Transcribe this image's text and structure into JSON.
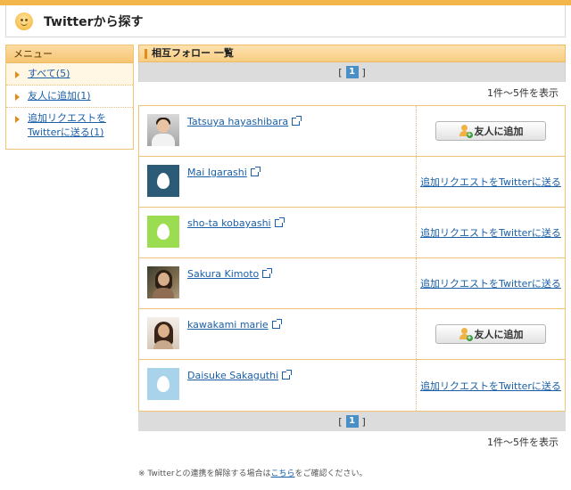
{
  "header": {
    "title": "Twitterから探す"
  },
  "sidebar": {
    "heading": "メニュー",
    "items": [
      {
        "label": "すべて(5)"
      },
      {
        "label": "友人に追加(1)"
      },
      {
        "label_line1": "追加リクエストを",
        "label_line2": "Twitterに送る(1)"
      }
    ]
  },
  "main": {
    "section_title": "相互フォロー 一覧",
    "pager": {
      "open": "[",
      "current": "1",
      "close": "]"
    },
    "count_text": "1件～5件を表示",
    "add_button_label": "友人に追加",
    "request_link_label": "追加リクエストをTwitterに送る",
    "friends": [
      {
        "name": "Tatsuya hayashibara",
        "action": "add"
      },
      {
        "name": "Mai Igarashi",
        "action": "request"
      },
      {
        "name": "sho-ta kobayashi",
        "action": "request"
      },
      {
        "name": "Sakura Kimoto",
        "action": "request"
      },
      {
        "name": "kawakami marie",
        "action": "add"
      },
      {
        "name": "Daisuke Sakaguthi",
        "action": "request"
      }
    ]
  },
  "footer": {
    "note_before": "※ Twitterとの連携を解除する場合は",
    "note_link": "こちら",
    "note_after": "をご確認ください。"
  },
  "colors": {
    "accent": "#f3b64a",
    "link": "#1a5fa8",
    "pager_current": "#4a90c4"
  }
}
